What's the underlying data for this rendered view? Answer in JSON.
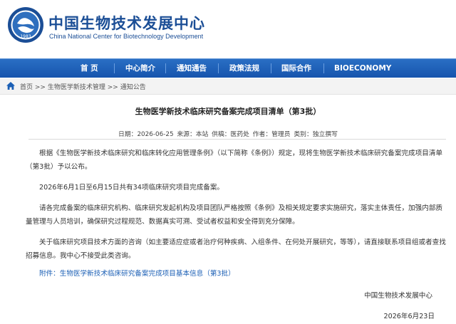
{
  "header": {
    "title_cn": "中国生物技术发展中心",
    "title_en": "China National Center for Biotechnology Development",
    "logo": {
      "year": "1983",
      "icon": "cncbd-logo",
      "color": "#1b4e96"
    }
  },
  "nav": {
    "items": [
      {
        "label": "首 页"
      },
      {
        "label": "中心简介"
      },
      {
        "label": "通知通告"
      },
      {
        "label": "政策法规"
      },
      {
        "label": "国际合作"
      },
      {
        "label": "BIOECONOMY"
      }
    ],
    "color": "#1b5fb5"
  },
  "breadcrumb": {
    "icon": "home-icon",
    "home": "首页",
    "sep": ">>",
    "level1": "生物医学新技术管理",
    "level2": "通知公告"
  },
  "article": {
    "title": "生物医学新技术临床研究备案完成项目清单（第3批）",
    "meta": {
      "date": "日期：2026-06-25",
      "source": "来源：本站",
      "provider": "供稿：医药处",
      "author": "作者：管理员",
      "category": "类别：独立撰写"
    },
    "paragraphs": [
      "根据《生物医学新技术临床研究和临床转化应用管理条例》（以下简称《条例》）规定，现将生物医学新技术临床研究备案完成项目清单（第3批）予以公布。",
      "2026年6月1日至6月15日共有34项临床研究项目完成备案。",
      "请各完成备案的临床研究机构、临床研究发起机构及项目团队严格按照《条例》及相关规定要求实施研究，落实主体责任，加强内部质量管理与人员培训，确保研究过程规范、数据真实可溯、受试者权益和安全得到充分保障。",
      "关于临床研究项目技术方面的咨询（如主要适应症或者治疗何种疾病、入组条件、在何处开展研究，等等），请直接联系项目组或者查找招募信息。我中心不接受此类咨询。"
    ],
    "attachment": "附件：生物医学新技术临床研究备案完成项目基本信息（第3批）",
    "signature": "中国生物技术发展中心",
    "sign_date": "2026年6月23日"
  }
}
